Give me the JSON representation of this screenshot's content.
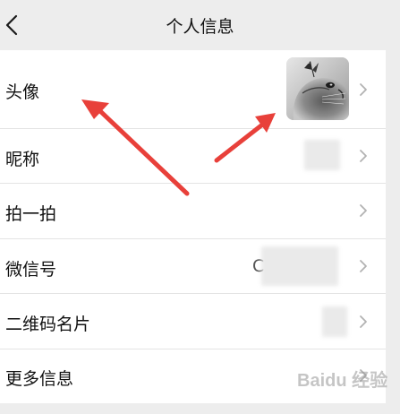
{
  "header": {
    "title": "个人信息"
  },
  "rows": [
    {
      "label": "头像"
    },
    {
      "label": "昵称"
    },
    {
      "label": "拍一拍"
    },
    {
      "label": "微信号"
    },
    {
      "label": "二维码名片"
    },
    {
      "label": "更多信息"
    }
  ],
  "values": {
    "wechat_id_fragment": "C"
  },
  "icons": {
    "back": "chevron-left-icon",
    "row_chevron": "chevron-right-icon"
  },
  "watermark": "Baidu 经验",
  "colors": {
    "background": "#ededed",
    "card": "#ffffff",
    "arrow": "#e8403a",
    "chevron": "#b2b2b2"
  }
}
